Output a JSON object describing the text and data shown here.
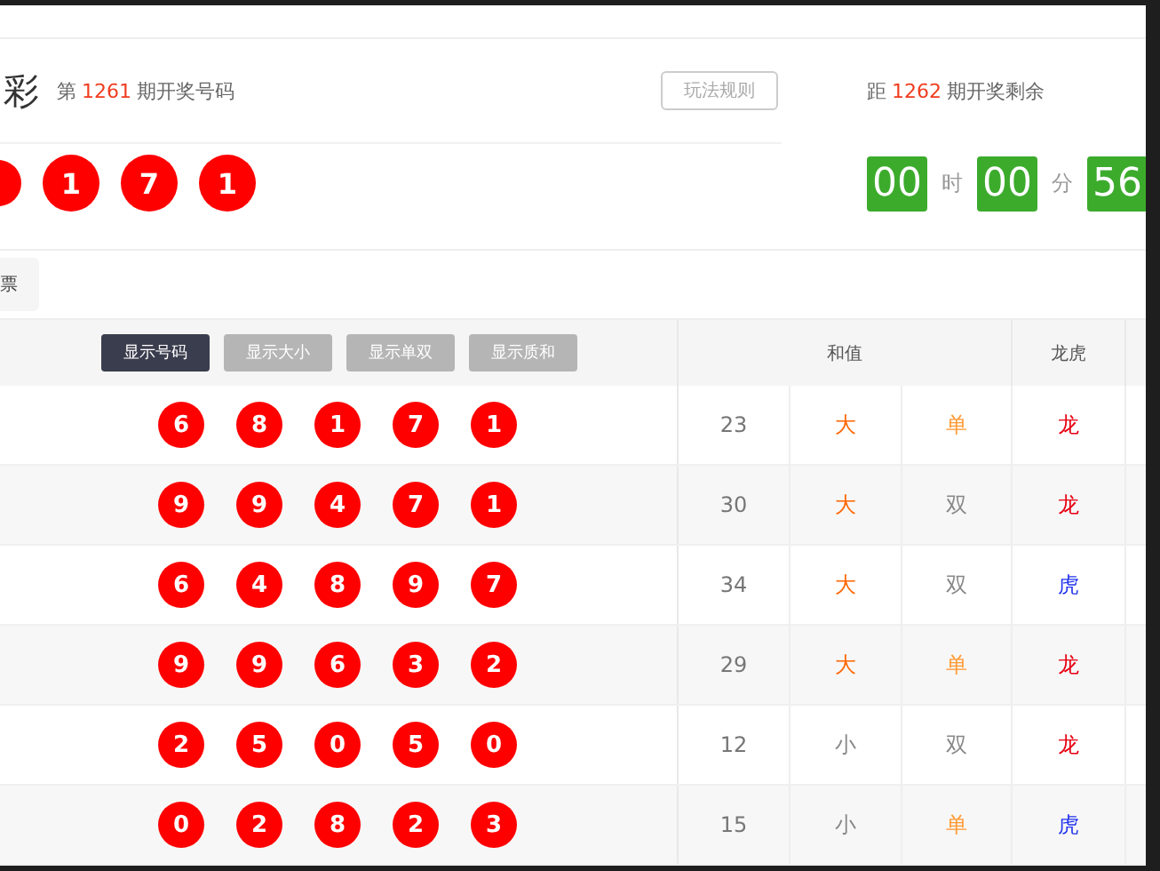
{
  "header": {
    "title_fragment": "彩",
    "issue_prefix": "第",
    "issue": "1261",
    "issue_suffix": "期开奖号码",
    "rules_button": "玩法规则",
    "next_prefix": "距",
    "next_issue": "1262",
    "next_suffix": "期开奖剩余"
  },
  "latest_balls": [
    "1",
    "7",
    "1"
  ],
  "countdown": [
    {
      "value": "00",
      "unit": "时"
    },
    {
      "value": "00",
      "unit": "分"
    },
    {
      "value": "56"
    }
  ],
  "tab": {
    "label": "票"
  },
  "table": {
    "toggles": [
      {
        "label": "显示号码",
        "selected": true
      },
      {
        "label": "显示大小",
        "selected": false
      },
      {
        "label": "显示单双",
        "selected": false
      },
      {
        "label": "显示质和",
        "selected": false
      }
    ],
    "columns": [
      {
        "label": "和值"
      },
      {
        "label": "龙虎"
      }
    ],
    "rows": [
      {
        "balls": [
          "6",
          "8",
          "1",
          "7",
          "1"
        ],
        "sum": "23",
        "size": {
          "text": "大",
          "color": "#ff6600"
        },
        "parity": {
          "text": "单",
          "color": "#ff9933"
        },
        "dragon": {
          "text": "龙",
          "color": "#e60012"
        }
      },
      {
        "balls": [
          "9",
          "9",
          "4",
          "7",
          "1"
        ],
        "sum": "30",
        "size": {
          "text": "大",
          "color": "#ff6600"
        },
        "parity": {
          "text": "双",
          "color": "#888888"
        },
        "dragon": {
          "text": "龙",
          "color": "#e60012"
        }
      },
      {
        "balls": [
          "6",
          "4",
          "8",
          "9",
          "7"
        ],
        "sum": "34",
        "size": {
          "text": "大",
          "color": "#ff6600"
        },
        "parity": {
          "text": "双",
          "color": "#888888"
        },
        "dragon": {
          "text": "虎",
          "color": "#2233ee"
        }
      },
      {
        "balls": [
          "9",
          "9",
          "6",
          "3",
          "2"
        ],
        "sum": "29",
        "size": {
          "text": "大",
          "color": "#ff6600"
        },
        "parity": {
          "text": "单",
          "color": "#ff9933"
        },
        "dragon": {
          "text": "龙",
          "color": "#e60012"
        }
      },
      {
        "balls": [
          "2",
          "5",
          "0",
          "5",
          "0"
        ],
        "sum": "12",
        "size": {
          "text": "小",
          "color": "#888888"
        },
        "parity": {
          "text": "双",
          "color": "#888888"
        },
        "dragon": {
          "text": "龙",
          "color": "#e60012"
        }
      },
      {
        "balls": [
          "0",
          "2",
          "8",
          "2",
          "3"
        ],
        "sum": "15",
        "size": {
          "text": "小",
          "color": "#888888"
        },
        "parity": {
          "text": "单",
          "color": "#ff9933"
        },
        "dragon": {
          "text": "虎",
          "color": "#2233ee"
        }
      }
    ]
  }
}
